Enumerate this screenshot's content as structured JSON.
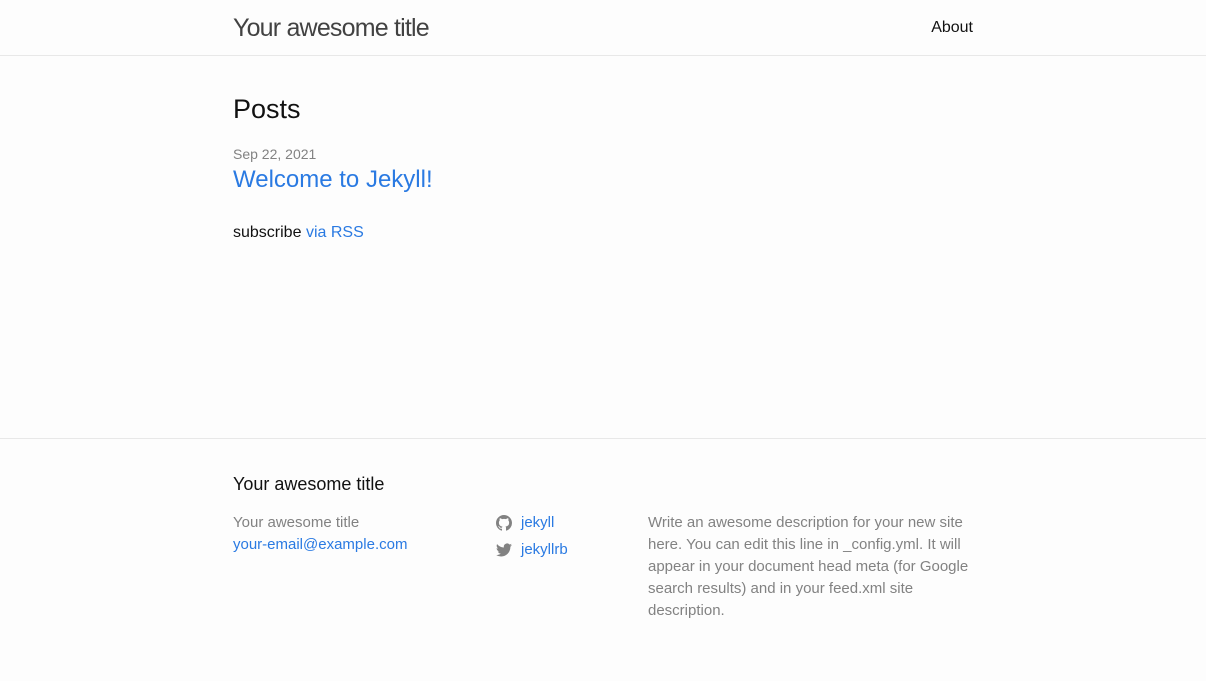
{
  "header": {
    "site_title": "Your awesome title",
    "nav": [
      {
        "label": "About"
      }
    ]
  },
  "main": {
    "heading": "Posts",
    "posts": [
      {
        "date": "Sep 22, 2021",
        "title": "Welcome to Jekyll!"
      }
    ],
    "rss": {
      "prefix": "subscribe",
      "link_label": "via RSS"
    }
  },
  "footer": {
    "heading": "Your awesome title",
    "contact": {
      "name": "Your awesome title",
      "email": "your-email@example.com"
    },
    "social": [
      {
        "icon": "github-icon",
        "label": "jekyll"
      },
      {
        "icon": "twitter-icon",
        "label": "jekyllrb"
      }
    ],
    "description": "Write an awesome description for your new site here. You can edit this line in _config.yml. It will appear in your document head meta (for Google search results) and in your feed.xml site description."
  },
  "colors": {
    "link": "#2a7ae2",
    "muted": "#828282",
    "text": "#111111",
    "background": "#fdfdfd",
    "border": "#e8e8e8"
  }
}
